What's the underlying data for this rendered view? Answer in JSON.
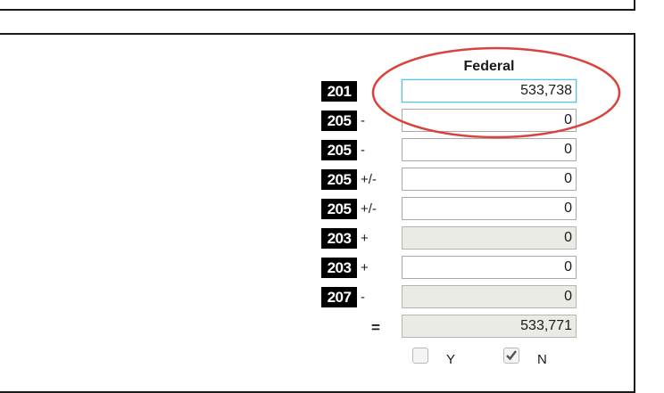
{
  "form": {
    "column_header": "Federal",
    "rows": [
      {
        "line": "201",
        "op": "",
        "value": "533,738",
        "readonly": false,
        "focused": true
      },
      {
        "line": "205",
        "op": "-",
        "value": "0",
        "readonly": false,
        "focused": false
      },
      {
        "line": "205",
        "op": "-",
        "value": "0",
        "readonly": false,
        "focused": false
      },
      {
        "line": "205",
        "op": "+/-",
        "value": "0",
        "readonly": false,
        "focused": false
      },
      {
        "line": "205",
        "op": "+/-",
        "value": "0",
        "readonly": false,
        "focused": false
      },
      {
        "line": "203",
        "op": "+",
        "value": "0",
        "readonly": true,
        "focused": false
      },
      {
        "line": "203",
        "op": "+",
        "value": "0",
        "readonly": false,
        "focused": false
      },
      {
        "line": "207",
        "op": "-",
        "value": "0",
        "readonly": true,
        "focused": false
      }
    ],
    "total": {
      "op": "=",
      "value": "533,771"
    },
    "yes_no": {
      "yes_label": "Y",
      "no_label": "N",
      "yes_checked": false,
      "no_checked": true
    }
  },
  "annotation": {
    "color": "#d9433b",
    "target": "Federal line 201 field"
  },
  "colors": {
    "badge_bg": "#000000",
    "badge_text": "#ffffff",
    "readonly_bg": "#ebebe6",
    "focus_border": "#5bc4e8"
  }
}
